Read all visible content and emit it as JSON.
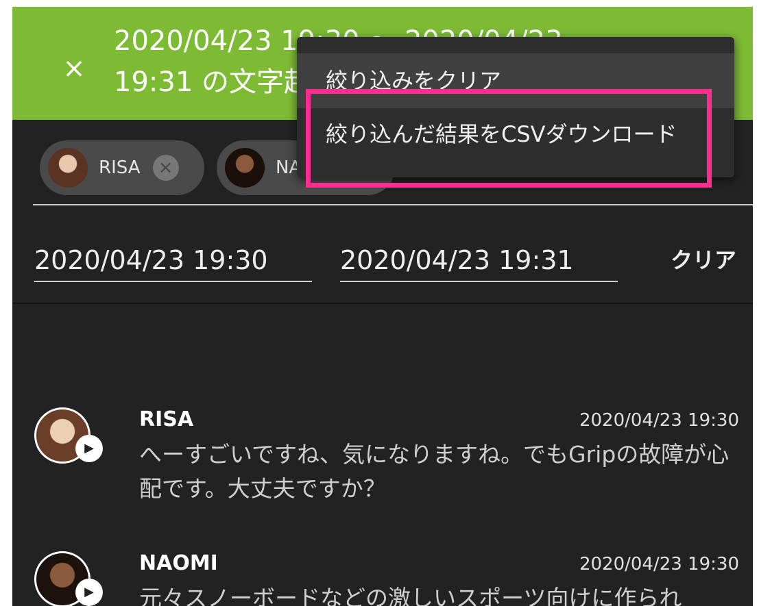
{
  "header": {
    "close_icon": "×",
    "title": "2020/04/23 19:30 〜 2020/04/23\n19:31 の文字起こし"
  },
  "chips": [
    {
      "label": "RISA",
      "remove_icon": "×"
    },
    {
      "label": "NAOMI"
    }
  ],
  "filter": {
    "start_value": "2020/04/23 19:30",
    "end_value": "2020/04/23 19:31",
    "clear_label": "クリア"
  },
  "menu": {
    "items": [
      {
        "label": "絞り込みをクリア"
      },
      {
        "label": "絞り込んだ結果をCSVダウンロード"
      }
    ]
  },
  "messages": [
    {
      "name": "RISA",
      "time": "2020/04/23 19:30",
      "text": "へーすごいですね、気になりますね。でもGripの故障が心配です。大丈夫ですか？"
    },
    {
      "name": "NAOMI",
      "time": "2020/04/23 19:30",
      "text": "元々スノーボードなどの激しいスポーツ向けに作られ"
    }
  ],
  "colors": {
    "header_green": "#7dbb35",
    "background": "#222222",
    "highlight": "#ff2d8f"
  },
  "icons": {
    "close": "close-icon",
    "chip_remove": "remove-circle-icon",
    "play": "play-icon"
  }
}
